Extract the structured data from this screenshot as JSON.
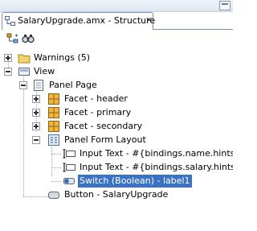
{
  "tab": {
    "title": "SalaryUpgrade.amx - Structure",
    "close": "×"
  },
  "toolbar": {
    "buttons": [
      "hierarchy-icon",
      "find-icon"
    ]
  },
  "tree": {
    "warnings": "Warnings (5)",
    "view": "View",
    "panel_page": "Panel Page",
    "facet_header": "Facet - header",
    "facet_primary": "Facet - primary",
    "facet_secondary": "Facet - secondary",
    "panel_form_layout": "Panel Form Layout",
    "input_text_1": "Input Text - #{bindings.name.hints.label}",
    "input_text_2": "Input Text - #{bindings.salary.hints.label}",
    "switch": "Switch (Boolean) - label1",
    "button": "Button - SalaryUpgrade"
  },
  "colors": {
    "selection": "#3a73c4",
    "facet_icon": "#f2b43c",
    "folder": "#f3d36b"
  }
}
